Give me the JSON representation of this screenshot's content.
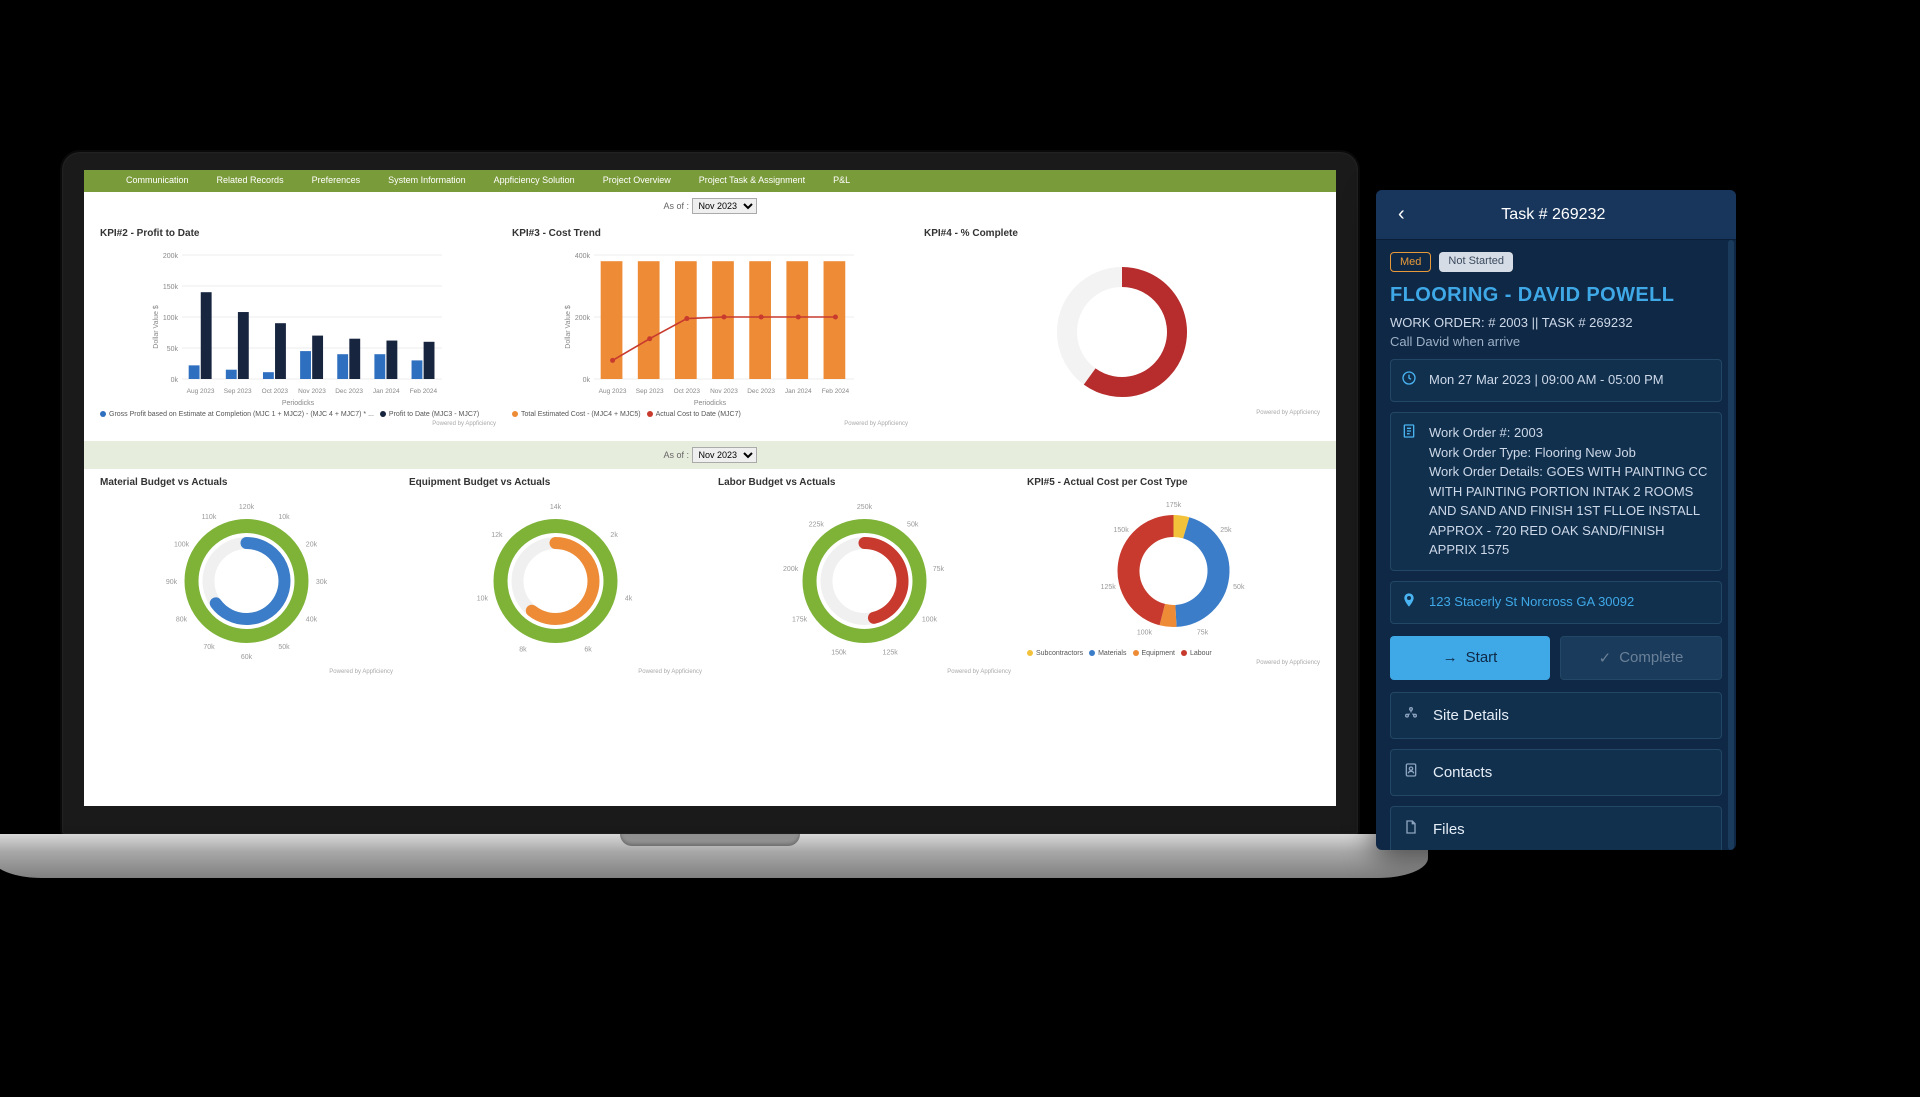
{
  "nav": {
    "tabs": [
      "Communication",
      "Related Records",
      "Preferences",
      "System Information",
      "Appficiency Solution",
      "Project Overview",
      "Project Task & Assignment",
      "P&L"
    ]
  },
  "asof": {
    "label": "As of :",
    "selected": "Nov 2023"
  },
  "row1": {
    "kpi2": {
      "title": "KPI#2 - Profit to Date"
    },
    "kpi3": {
      "title": "KPI#3 - Cost Trend"
    },
    "kpi4": {
      "title": "KPI#4 - % Complete"
    }
  },
  "row2": {
    "mat": {
      "title": "Material Budget vs Actuals"
    },
    "eq": {
      "title": "Equipment Budget vs Actuals"
    },
    "lab": {
      "title": "Labor Budget vs Actuals"
    },
    "kpi5": {
      "title": "KPI#5 - Actual Cost per Cost Type"
    }
  },
  "legends": {
    "kpi2": [
      "Gross Profit based on Estimate at Completion (MJC 1 + MJC2) - (MJC 4 + MJC7) * ...",
      "Profit to Date (MJC3 - MJC7)"
    ],
    "kpi3": [
      "Total Estimated Cost - (MJC4 + MJC5)",
      "Actual Cost to Date (MJC7)"
    ],
    "kpi5": [
      "Subcontractors",
      "Materials",
      "Equipment",
      "Labour"
    ]
  },
  "footnote": "Powered by Appficiency",
  "donut_ticks": {
    "mat": [
      "120k",
      "10k",
      "20k",
      "30k",
      "40k",
      "50k",
      "60k",
      "70k",
      "80k",
      "90k",
      "100k",
      "110k"
    ],
    "eq": [
      "14k",
      "2k",
      "4k",
      "6k",
      "8k",
      "10k",
      "12k"
    ],
    "lab": [
      "250k",
      "50k",
      "75k",
      "100k",
      "125k",
      "150k",
      "175k",
      "200k",
      "225k"
    ],
    "kpi5": [
      "175k",
      "25k",
      "50k",
      "75k",
      "100k",
      "125k",
      "150k"
    ]
  },
  "chart_data": [
    {
      "id": "kpi2",
      "type": "bar",
      "title": "KPI#2 - Profit to Date",
      "xlabel": "Periodicks",
      "ylabel": "Dollar Value $",
      "ylim": [
        0,
        200000
      ],
      "yticks": [
        0,
        50000,
        100000,
        150000,
        200000
      ],
      "categories": [
        "Aug 2023",
        "Sep 2023",
        "Oct 2023",
        "Nov 2023",
        "Dec 2023",
        "Jan 2024",
        "Feb 2024"
      ],
      "series": [
        {
          "name": "Gross Profit based on Estimate at Completion",
          "color": "#2f6fbf",
          "values": [
            22000,
            15000,
            11000,
            45000,
            40000,
            40000,
            30000
          ]
        },
        {
          "name": "Profit to Date",
          "color": "#17253f",
          "values": [
            140000,
            108000,
            90000,
            70000,
            65000,
            62000,
            60000
          ]
        }
      ]
    },
    {
      "id": "kpi3",
      "type": "bar+line",
      "title": "KPI#3 - Cost Trend",
      "xlabel": "Periodicks",
      "ylabel": "Dollar Value $",
      "ylim": [
        0,
        400000
      ],
      "yticks": [
        0,
        200000,
        400000
      ],
      "categories": [
        "Aug 2023",
        "Sep 2023",
        "Oct 2023",
        "Nov 2023",
        "Dec 2023",
        "Jan 2024",
        "Feb 2024"
      ],
      "series": [
        {
          "name": "Total Estimated Cost",
          "type": "bar",
          "color": "#ed8b36",
          "values": [
            380000,
            380000,
            380000,
            380000,
            380000,
            380000,
            380000
          ]
        },
        {
          "name": "Actual Cost to Date",
          "type": "line",
          "color": "#c83a2e",
          "values": [
            60000,
            130000,
            195000,
            200000,
            200000,
            200000,
            200000
          ]
        }
      ]
    },
    {
      "id": "kpi4",
      "type": "gauge",
      "title": "KPI#4 - % Complete",
      "value_pct": 60,
      "color": "#b72c2c"
    },
    {
      "id": "material",
      "type": "donut-gauge",
      "title": "Material Budget vs Actuals",
      "outer": {
        "name": "Budget",
        "color": "#7eb338",
        "value": 120000,
        "max": 120000
      },
      "inner": {
        "name": "Actual",
        "color": "#3b7dc9",
        "value": 78000,
        "max": 120000
      },
      "tick_max": 120000
    },
    {
      "id": "equipment",
      "type": "donut-gauge",
      "title": "Equipment Budget vs Actuals",
      "outer": {
        "name": "Budget",
        "color": "#7eb338",
        "value": 14000,
        "max": 14000
      },
      "inner": {
        "name": "Actual",
        "color": "#ed8b36",
        "value": 8500,
        "max": 14000
      },
      "tick_max": 14000
    },
    {
      "id": "labor",
      "type": "donut-gauge",
      "title": "Labor Budget vs Actuals",
      "outer": {
        "name": "Budget",
        "color": "#7eb338",
        "value": 250000,
        "max": 250000
      },
      "inner": {
        "name": "Actual",
        "color": "#c83a2e",
        "value": 115000,
        "max": 250000
      },
      "tick_max": 250000
    },
    {
      "id": "kpi5",
      "type": "donut",
      "title": "KPI#5 - Actual Cost per Cost Type",
      "total_tick_max": 175000,
      "slices": [
        {
          "name": "Subcontractors",
          "color": "#f2c23a",
          "value": 8000
        },
        {
          "name": "Materials",
          "color": "#3b7dc9",
          "value": 78000
        },
        {
          "name": "Equipment",
          "color": "#ed8b36",
          "value": 8500
        },
        {
          "name": "Labour",
          "color": "#c83a2e",
          "value": 80500
        }
      ]
    }
  ],
  "phone": {
    "header": "Task # 269232",
    "badges": {
      "priority": "Med",
      "status": "Not Started"
    },
    "title": "FLOORING - DAVID POWELL",
    "wo_line": "WORK ORDER: # 2003 || TASK # 269232",
    "note": "Call David when arrive",
    "datetime": "Mon 27 Mar  2023 | 09:00 AM - 05:00 PM",
    "details": {
      "l1": "Work Order #: 2003",
      "l2": "Work Order Type: Flooring New Job",
      "l3": "Work Order Details: GOES WITH PAINTING CC WITH PAINTING PORTION INTAK 2 ROOMS AND SAND AND FINISH 1ST FLLOE INSTALL APPROX - 720 RED OAK SAND/FINISH APPRIX 1575"
    },
    "address": "123 Stacerly St Norcross GA 30092",
    "buttons": {
      "start": "Start",
      "complete": "Complete"
    },
    "accordion": [
      "Site Details",
      "Contacts",
      "Files"
    ]
  }
}
